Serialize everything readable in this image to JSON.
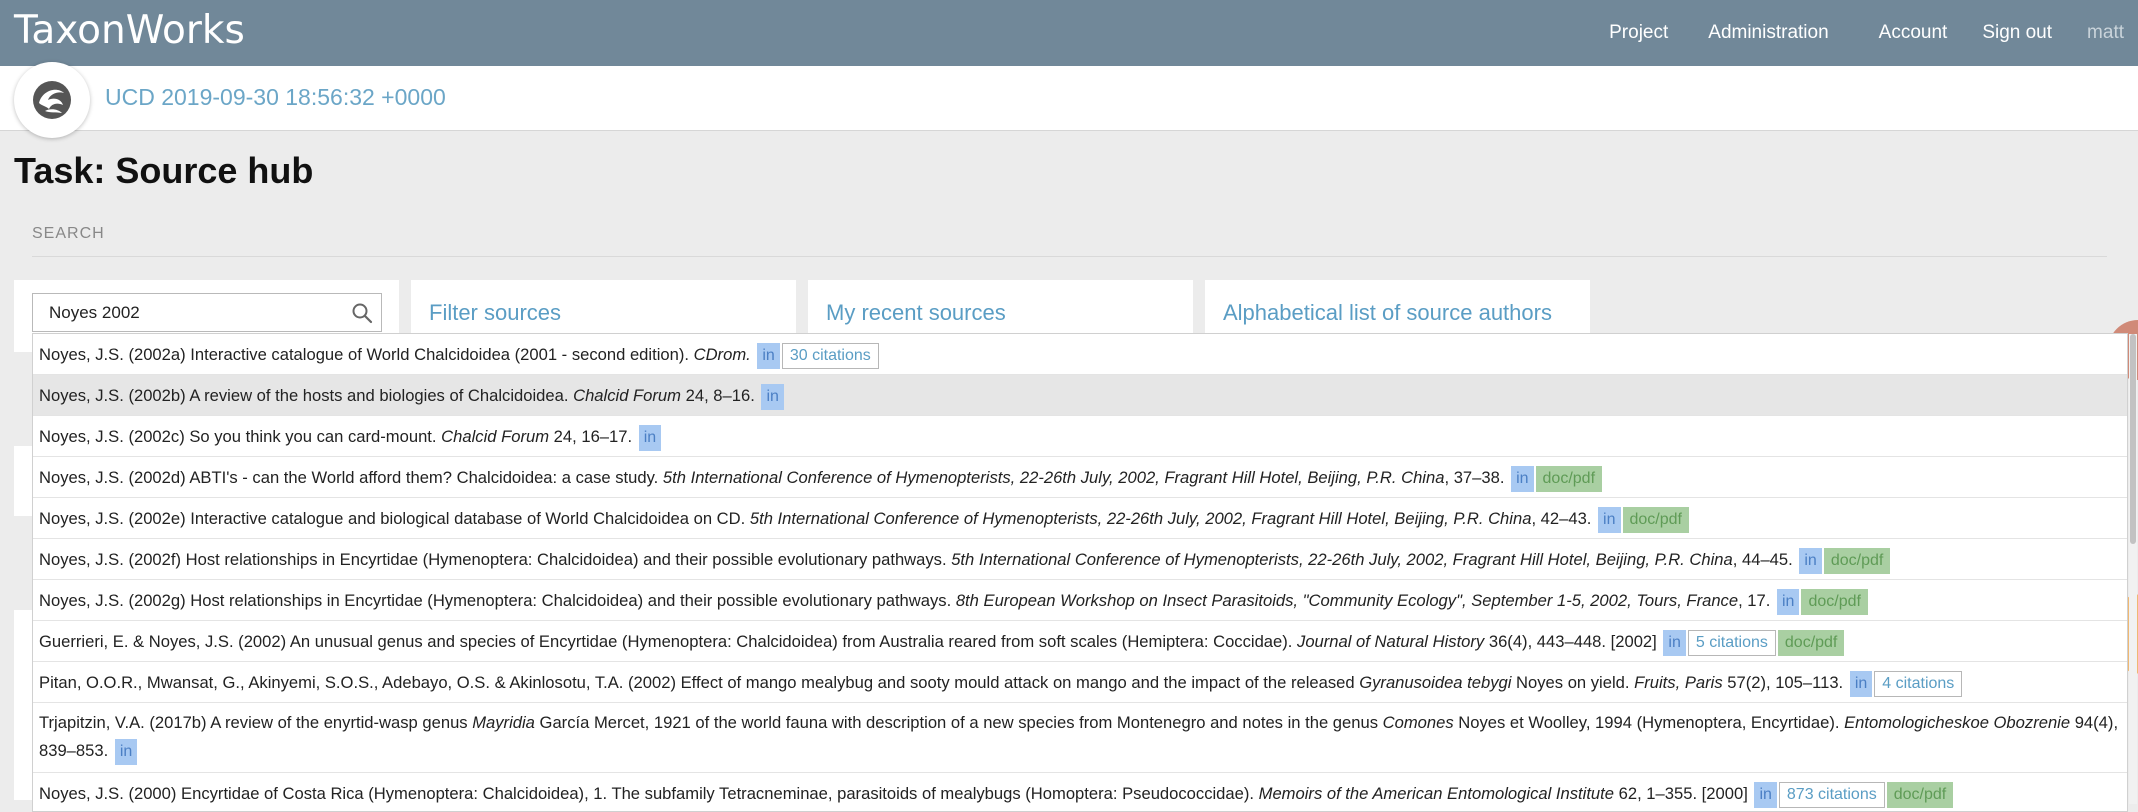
{
  "app": {
    "brand": "TaxonWorks"
  },
  "nav": {
    "project": "Project",
    "administration": "Administration",
    "account": "Account",
    "sign_out": "Sign out",
    "user": "matt"
  },
  "project": {
    "name": "UCD 2019-09-30 18:56:32 +0000"
  },
  "page": {
    "title": "Task: Source hub",
    "search_label": "SEARCH"
  },
  "search": {
    "value": "Noyes 2002"
  },
  "panels": {
    "filter": "Filter sources",
    "recent": "My recent sources",
    "authors": "Alphabetical list of source authors"
  },
  "badge_labels": {
    "in": "in",
    "doc": "doc/pdf"
  },
  "results": [
    {
      "main": "Noyes, J.S. (2002a) Interactive catalogue of World Chalcidoidea (2001 - second edition). ",
      "journal": "CDrom.",
      "tail": "",
      "citations": "30 citations",
      "doc": false,
      "highlight": false
    },
    {
      "main": "Noyes, J.S. (2002b) A review of the hosts and biologies of Chalcidoidea. ",
      "journal": "Chalcid Forum",
      "tail": " 24, 8–16.",
      "citations": "",
      "doc": false,
      "highlight": true
    },
    {
      "main": "Noyes, J.S. (2002c) So you think you can card-mount. ",
      "journal": "Chalcid Forum",
      "tail": " 24, 16–17.",
      "citations": "",
      "doc": false,
      "highlight": false
    },
    {
      "main": "Noyes, J.S. (2002d) ABTI's - can the World afford them? Chalcidoidea: a case study. ",
      "journal": "5th International Conference of Hymenopterists, 22-26th July, 2002, Fragrant Hill Hotel, Beijing, P.R. China",
      "tail": ", 37–38.",
      "citations": "",
      "doc": true,
      "highlight": false
    },
    {
      "main": "Noyes, J.S. (2002e) Interactive catalogue and biological database of World Chalcidoidea on CD. ",
      "journal": "5th International Conference of Hymenopterists, 22-26th July, 2002, Fragrant Hill Hotel, Beijing, P.R. China",
      "tail": ", 42–43.",
      "citations": "",
      "doc": true,
      "highlight": false
    },
    {
      "main": "Noyes, J.S. (2002f) Host relationships in Encyrtidae (Hymenoptera: Chalcidoidea) and their possible evolutionary pathways. ",
      "journal": "5th International Conference of Hymenopterists, 22-26th July, 2002, Fragrant Hill Hotel, Beijing, P.R. China",
      "tail": ", 44–45.",
      "citations": "",
      "doc": true,
      "highlight": false
    },
    {
      "main": "Noyes, J.S. (2002g) Host relationships in Encyrtidae (Hymenoptera: Chalcidoidea) and their possible evolutionary pathways. ",
      "journal": "8th European Workshop on Insect Parasitoids, \"Community Ecology\", September 1-5, 2002, Tours, France",
      "tail": ", 17.",
      "citations": "",
      "doc": true,
      "highlight": false
    },
    {
      "main": "Guerrieri, E. & Noyes, J.S. (2002) An unusual genus and species of Encyrtidae (Hymenoptera: Chalcidoidea) from Australia reared from soft scales (Hemiptera: Coccidae). ",
      "journal": "Journal of Natural History",
      "tail": " 36(4), 443–448. [2002]",
      "citations": "5 citations",
      "doc": true,
      "highlight": false
    },
    {
      "main": "Pitan, O.O.R., Mwansat, G., Akinyemi, S.O.S., Adebayo, O.S. & Akinlosotu, T.A. (2002) Effect of mango mealybug and sooty mould attack on mango and the impact of the released ",
      "species": "Gyranusoidea tebygi",
      "main2": " Noyes on yield. ",
      "journal": "Fruits, Paris",
      "tail": " 57(2), 105–113.",
      "citations": "4 citations",
      "doc": false,
      "highlight": false
    },
    {
      "main": "Trjapitzin, V.A. (2017b) A review of the enyrtid-wasp genus ",
      "genus": "Mayridia",
      "main2": " García Mercet, 1921 of the world fauna with description of a new species from Montenegro and notes in the genus ",
      "genus2": "Comones",
      "main3": " Noyes et Woolley, 1994 (Hymenoptera, Encyrtidae). ",
      "journal": "Entomologicheskoe Obozrenie",
      "tail": " 94(4), 839–853.",
      "citations": "",
      "doc": false,
      "highlight": false
    },
    {
      "main": "Noyes, J.S. (2000) Encyrtidae of Costa Rica (Hymenoptera: Chalcidoidea), 1. The subfamily Tetracneminae, parasitoids of mealybugs (Homoptera: Pseudococcidae). ",
      "journal": "Memoirs of the American Entomological Institute",
      "tail": " 62, 1–355. [2000]",
      "citations": "873 citations",
      "doc": true,
      "highlight": false
    }
  ],
  "colors": {
    "topbar": "#718899",
    "link": "#5a9dc4",
    "badge_in": "#a8c9f2",
    "badge_doc": "#a9cfa2",
    "highlight_row": "#e6e6e6"
  },
  "icons": {
    "search": "search-icon",
    "logo": "taxonworks-logo-icon"
  }
}
